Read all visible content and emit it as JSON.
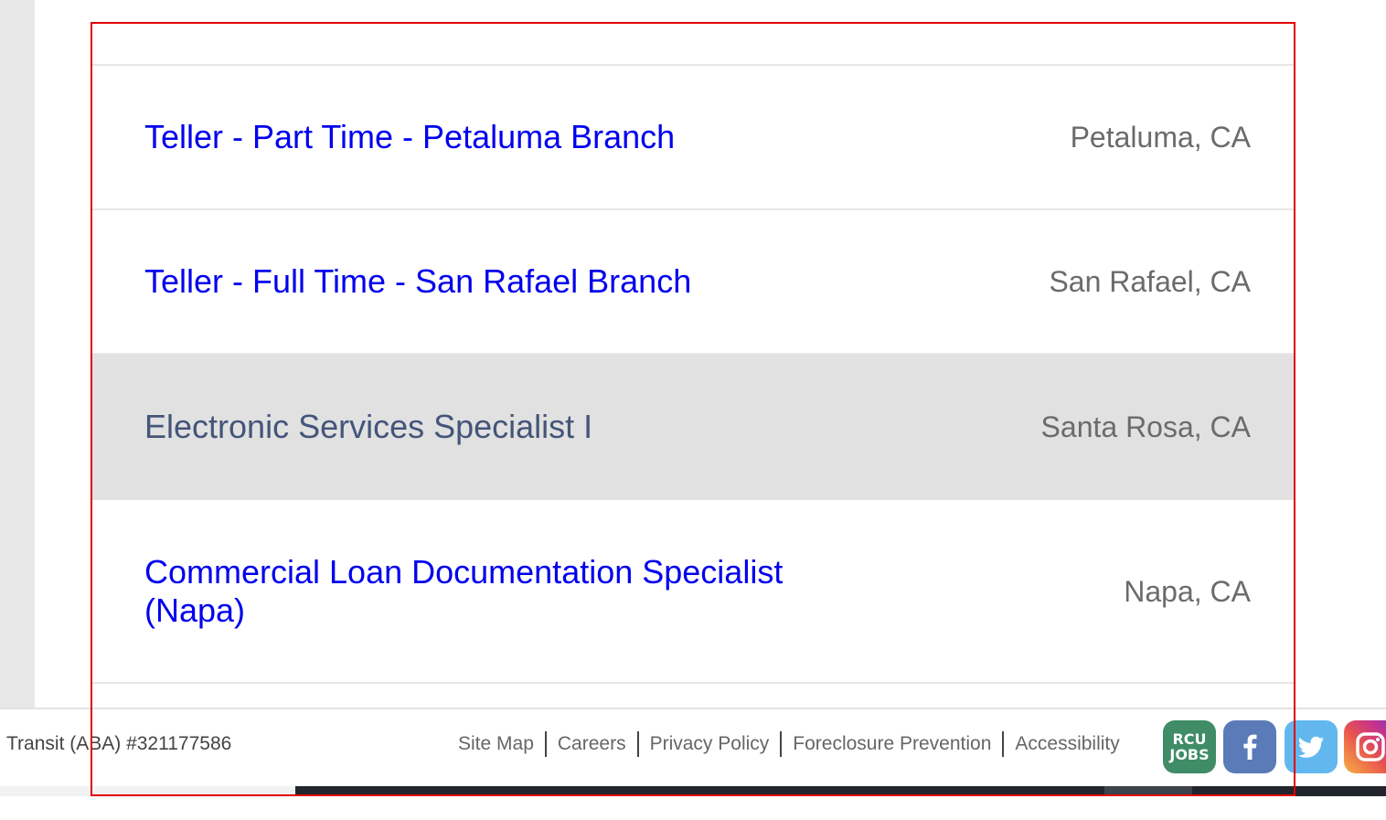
{
  "jobs": [
    {
      "title": "Teller - Part Time - Petaluma Branch",
      "location": "Petaluma, CA"
    },
    {
      "title": "Teller - Full Time - San Rafael Branch",
      "location": "San Rafael, CA"
    },
    {
      "title": "Electronic Services Specialist I",
      "location": "Santa Rosa, CA"
    },
    {
      "title": "Commercial Loan Documentation Specialist (Napa)",
      "location": "Napa, CA"
    }
  ],
  "footer": {
    "transit": "Transit (ABA) #321177586",
    "links": [
      "Site Map",
      "Careers",
      "Privacy Policy",
      "Foreclosure Prevention",
      "Accessibility"
    ],
    "social": {
      "rcu_jobs_line1": "RCU",
      "rcu_jobs_line2": "JOBS"
    }
  },
  "colors": {
    "link": "#0000ee",
    "hover_title": "#44557a",
    "location": "#6b6b6b",
    "highlight_row": "#e1e1e1",
    "frame": "#e00000"
  },
  "icons": [
    "rcu-jobs-icon",
    "facebook-icon",
    "twitter-icon",
    "instagram-icon"
  ]
}
